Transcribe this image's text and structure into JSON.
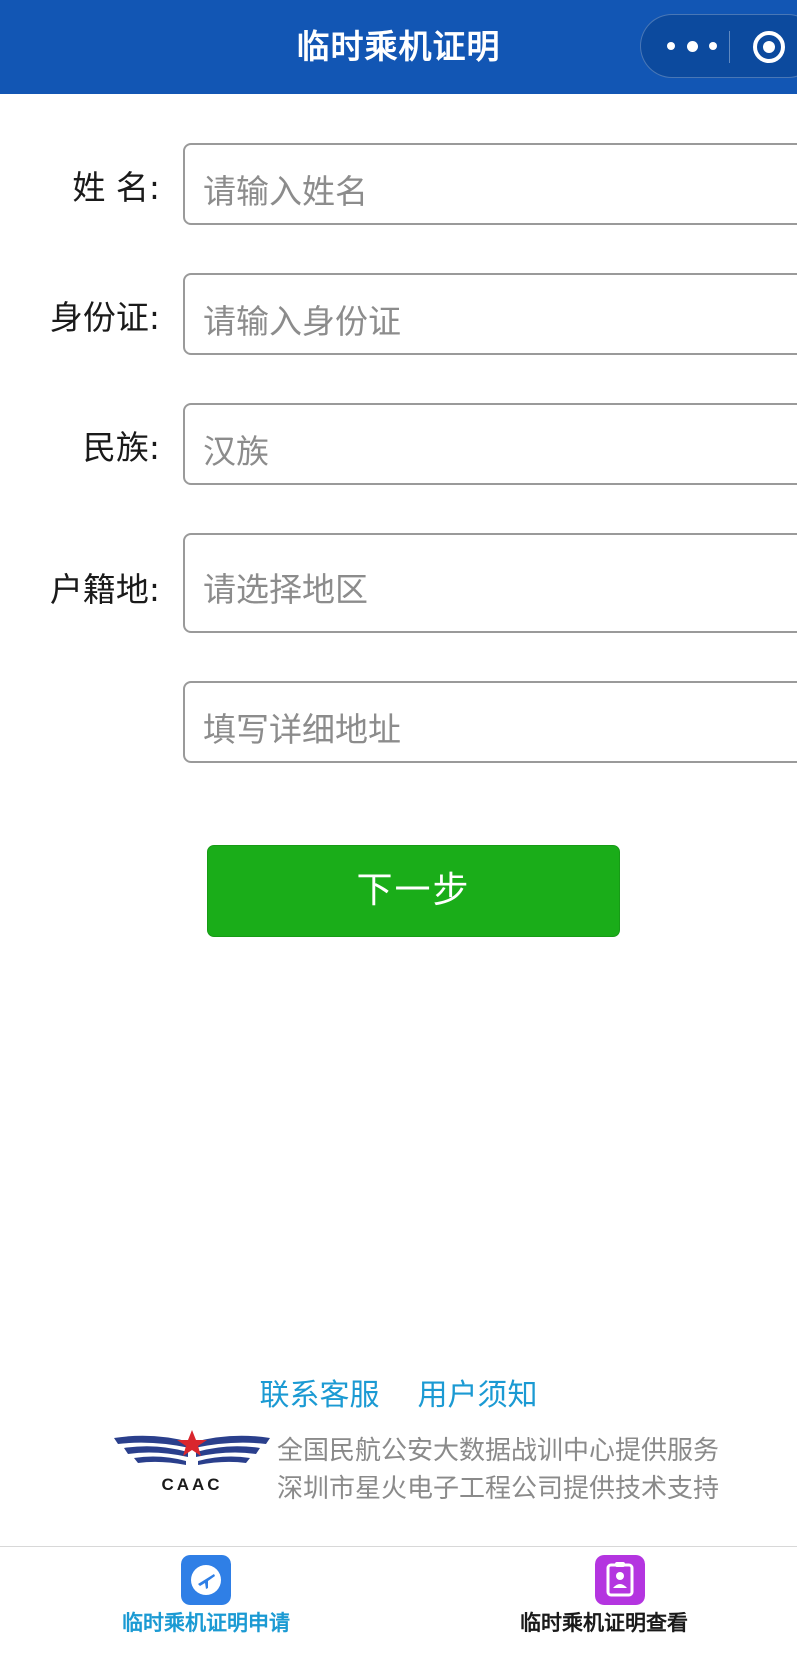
{
  "header": {
    "title": "临时乘机证明",
    "more_icon": "more-dots-icon",
    "close_icon": "target-close-icon",
    "bg_color": "#1256b4"
  },
  "form": {
    "name": {
      "label": "姓 名:",
      "placeholder": "请输入姓名"
    },
    "id_card": {
      "label": "身份证:",
      "placeholder": "请输入身份证"
    },
    "ethnicity": {
      "label": "民族:",
      "value": "汉族"
    },
    "domicile": {
      "label": "户籍地:",
      "placeholder": "请选择地区"
    },
    "address": {
      "placeholder": "填写详细地址"
    }
  },
  "next_button": {
    "label": "下一步",
    "color": "#1aad19"
  },
  "footer": {
    "links": [
      "联系客服",
      "用户须知"
    ],
    "logo_text": "CAAC",
    "credits": [
      "全国民航公安大数据战训中心提供服务",
      "深圳市星火电子工程公司提供技术支持"
    ]
  },
  "tabbar": {
    "tabs": [
      {
        "label": "临时乘机证明申请",
        "icon": "airplane-icon",
        "active": true,
        "color": "#1b9ad3"
      },
      {
        "label": "临时乘机证明查看",
        "icon": "id-badge-icon",
        "active": false,
        "color": "#1a1a1a"
      }
    ]
  }
}
